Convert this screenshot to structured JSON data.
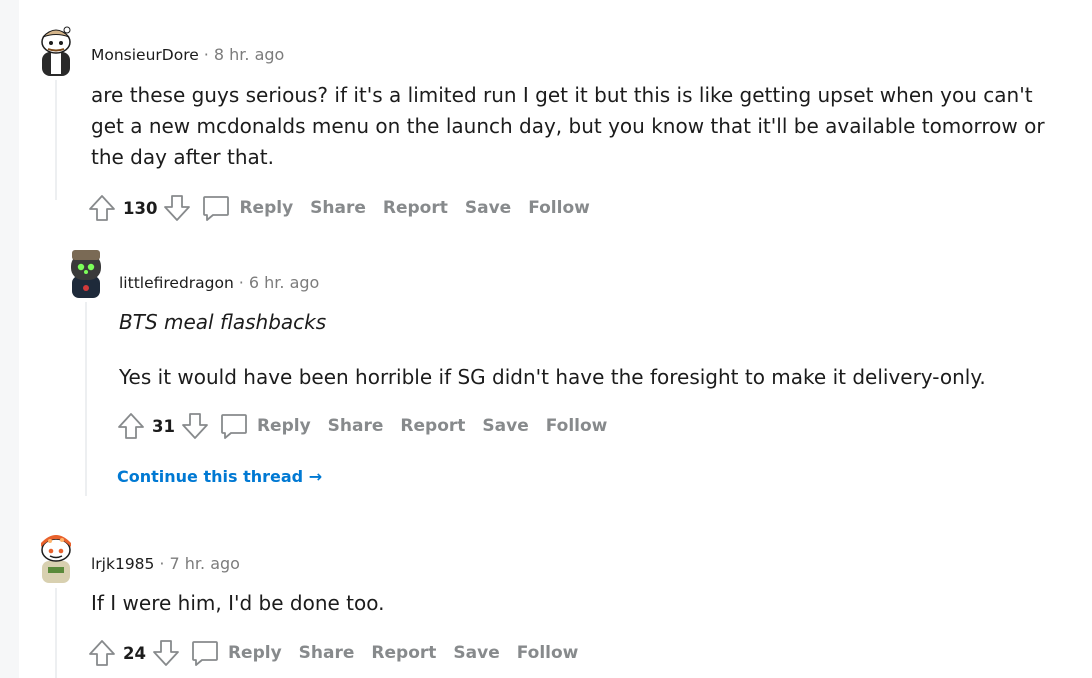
{
  "comments": [
    {
      "author": "MonsieurDore",
      "separator": "·",
      "time": "8 hr. ago",
      "body": [
        "are these guys serious? if it's a limited run I get it but this is like getting upset when you can't",
        "get a new mcdonalds menu on the launch day, but you know that it'll be available tomorrow or",
        "the day after that."
      ],
      "score": "130",
      "actions": {
        "reply": "Reply",
        "share": "Share",
        "report": "Report",
        "save": "Save",
        "follow": "Follow"
      }
    },
    {
      "author": "littlefiredragon",
      "separator": "·",
      "time": "6 hr. ago",
      "quote": "BTS meal flashbacks",
      "body": [
        "Yes it would have been horrible if SG didn't have the foresight to make it delivery-only."
      ],
      "score": "31",
      "actions": {
        "reply": "Reply",
        "share": "Share",
        "report": "Report",
        "save": "Save",
        "follow": "Follow"
      },
      "continue_label": "Continue this thread",
      "continue_arrow": "→"
    },
    {
      "author": "lrjk1985",
      "separator": "·",
      "time": "7 hr. ago",
      "body": [
        "If I were him, I'd be done too."
      ],
      "score": "24",
      "actions": {
        "reply": "Reply",
        "share": "Share",
        "report": "Report",
        "save": "Save",
        "follow": "Follow"
      }
    }
  ],
  "icons": {
    "upvote": "arrow-up-outline-icon",
    "downvote": "arrow-down-outline-icon",
    "reply": "speech-bubble-icon",
    "continue": "arrow-right-icon"
  },
  "colors": {
    "link": "#0079d3",
    "muted": "#878a8c",
    "text": "#1c1c1c",
    "thread_line": "#edeff1",
    "gutter": "#f6f7f8"
  }
}
